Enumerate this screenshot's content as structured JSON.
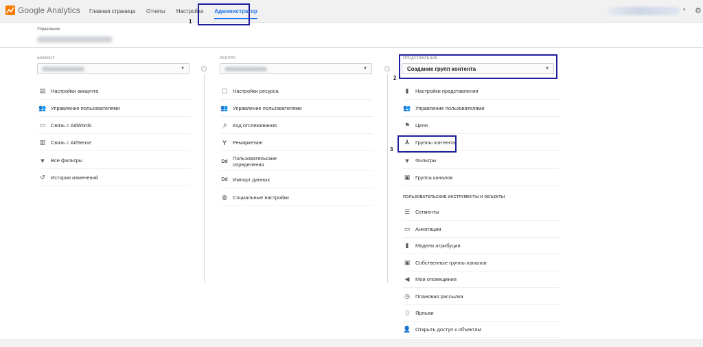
{
  "app": {
    "name": "Google Analytics",
    "logo_icon": "analytics-logo-icon"
  },
  "nav": {
    "items": [
      "Главная страница",
      "Отчеты",
      "Настройка",
      "Администратор"
    ],
    "active": "Администратор"
  },
  "markers": {
    "m1": "1",
    "m2": "2",
    "m3": "3"
  },
  "management": {
    "label": "Управление"
  },
  "account": {
    "title": "АККАУНТ",
    "items": [
      {
        "icon": "building-icon",
        "glyph": "▤",
        "label": "Настройки аккаунта"
      },
      {
        "icon": "users-icon",
        "glyph": "👥",
        "label": "Управление пользователями"
      },
      {
        "icon": "adwords-icon",
        "glyph": "▭",
        "label": "Связь с AdWords"
      },
      {
        "icon": "adsense-icon",
        "glyph": "▥",
        "label": "Связь с AdSense"
      },
      {
        "icon": "filter-icon",
        "glyph": "▼",
        "label": "Все фильтры"
      },
      {
        "icon": "history-icon",
        "glyph": "↺",
        "label": "История изменений"
      }
    ]
  },
  "property": {
    "title": "РЕСУРС",
    "items": [
      {
        "icon": "settings-page-icon",
        "glyph": "▢",
        "label": "Настройки ресурса"
      },
      {
        "icon": "users-icon",
        "glyph": "👥",
        "label": "Управление пользователями"
      },
      {
        "icon": "tracking-code-icon",
        "glyph": ".js",
        "label": "Код отслеживания"
      },
      {
        "icon": "remarketing-icon",
        "glyph": "Y",
        "label": "Ремаркетинг"
      },
      {
        "icon": "custom-definitions-icon",
        "glyph": "Dd",
        "label": "Пользовательские определения"
      },
      {
        "icon": "data-import-icon",
        "glyph": "Dd",
        "label": "Импорт данных"
      },
      {
        "icon": "globe-icon",
        "glyph": "◍",
        "label": "Социальные настройки"
      }
    ]
  },
  "view": {
    "title": "ПРЕДСТАВЛЕНИЕ",
    "selected": "Создание групп контента",
    "items": [
      {
        "icon": "document-icon",
        "glyph": "▮",
        "label": "Настройки представления"
      },
      {
        "icon": "users-icon",
        "glyph": "👥",
        "label": "Управление пользователями"
      },
      {
        "icon": "flag-icon",
        "glyph": "⚑",
        "label": "Цели"
      },
      {
        "icon": "content-grouping-icon",
        "glyph": "⅄",
        "label": "Группы контента"
      },
      {
        "icon": "filter-icon",
        "glyph": "▼",
        "label": "Фильтры"
      },
      {
        "icon": "channel-grouping-icon",
        "glyph": "▣",
        "label": "Группа каналов"
      }
    ],
    "tools_title": "ПОЛЬЗОВАТЕЛЬСКИЕ ИНСТРУМЕНТЫ И ОБЪЕКТЫ",
    "tools": [
      {
        "icon": "segments-icon",
        "glyph": "☰",
        "label": "Сегменты"
      },
      {
        "icon": "annotations-icon",
        "glyph": "▭",
        "label": "Аннотации"
      },
      {
        "icon": "attribution-icon",
        "glyph": "▮",
        "label": "Модели атрибуции"
      },
      {
        "icon": "custom-channels-icon",
        "glyph": "▣",
        "label": "Собственные группы каналов"
      },
      {
        "icon": "megaphone-icon",
        "glyph": "◀",
        "label": "Мои оповещения"
      },
      {
        "icon": "clock-icon",
        "glyph": "◷",
        "label": "Плановая рассылка"
      },
      {
        "icon": "shortcut-icon",
        "glyph": "▯",
        "label": "Ярлыки"
      },
      {
        "icon": "share-icon",
        "glyph": "👤",
        "label": "Открыть доступ к объектам"
      }
    ]
  }
}
